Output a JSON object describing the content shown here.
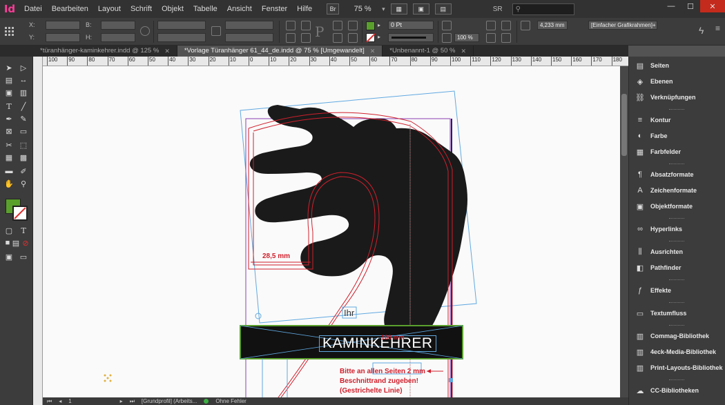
{
  "app": {
    "logo": "Id",
    "menu": [
      "Datei",
      "Bearbeiten",
      "Layout",
      "Schrift",
      "Objekt",
      "Tabelle",
      "Ansicht",
      "Fenster",
      "Hilfe"
    ],
    "bridge_label": "Br",
    "zoom": "75 %",
    "workspace": "SR",
    "search_placeholder": ""
  },
  "control_panel": {
    "x_label": "X:",
    "y_label": "Y:",
    "w_label": "B:",
    "h_label": "H:",
    "stroke_weight": "0 Pt",
    "scale_percent": "100 %",
    "offset_value": "4,233 mm",
    "frame_style": "[Einfacher Grafikrahmen]+"
  },
  "tabs": [
    {
      "label": "*türanhänger-kaminkehrer.indd @ 125 %",
      "active": false
    },
    {
      "label": "*Vorlage Türanhänger 61_44_de.indd @ 75 % [Umgewandelt]",
      "active": true
    },
    {
      "label": "*Unbenannt-1 @ 50 %",
      "active": false
    }
  ],
  "ruler": {
    "top_labels": [
      "100",
      "90",
      "80",
      "70",
      "60",
      "50",
      "40",
      "30",
      "20",
      "10",
      "0",
      "10",
      "20",
      "30",
      "40",
      "50",
      "60",
      "70",
      "80",
      "90",
      "100",
      "110",
      "120",
      "130",
      "140",
      "150",
      "160",
      "170",
      "180"
    ]
  },
  "canvas": {
    "dimension_label": "28,5 mm",
    "small_frame_text": "Ihr",
    "banner_text": "KAMINKEHRER",
    "banner_overlay_text": "100 mm",
    "note_lines": [
      "Bitte an allen Seiten 2 mm",
      "Beschnittrand zugeben!",
      "(Gestrichelte Linie)"
    ],
    "colors": {
      "guide_red": "#d0202c",
      "frame_blue": "#5fa8e0",
      "frame_purple": "#8a3fb3",
      "banner_border": "#5aa02c"
    }
  },
  "status": {
    "page": "1",
    "profile": "[Grundprofil] (Arbeits...",
    "errors": "Ohne Fehler"
  },
  "panels": [
    {
      "label": "Seiten",
      "icon": "pages-icon"
    },
    {
      "label": "Ebenen",
      "icon": "layers-icon"
    },
    {
      "label": "Verknüpfungen",
      "icon": "links-icon"
    },
    {
      "label": "Kontur",
      "icon": "stroke-icon"
    },
    {
      "label": "Farbe",
      "icon": "color-icon"
    },
    {
      "label": "Farbfelder",
      "icon": "swatches-icon"
    },
    {
      "label": "Absatzformate",
      "icon": "paragraph-styles-icon"
    },
    {
      "label": "Zeichenformate",
      "icon": "character-styles-icon"
    },
    {
      "label": "Objektformate",
      "icon": "object-styles-icon"
    },
    {
      "label": "Hyperlinks",
      "icon": "hyperlinks-icon"
    },
    {
      "label": "Ausrichten",
      "icon": "align-icon"
    },
    {
      "label": "Pathfinder",
      "icon": "pathfinder-icon"
    },
    {
      "label": "Effekte",
      "icon": "effects-icon"
    },
    {
      "label": "Textumfluss",
      "icon": "text-wrap-icon"
    },
    {
      "label": "Commag-Bibliothek",
      "icon": "library-icon"
    },
    {
      "label": "4eck-Media-Bibliothek",
      "icon": "library-icon"
    },
    {
      "label": "Print-Layouts-Bibliothek",
      "icon": "library-icon"
    },
    {
      "label": "CC-Bibliotheken",
      "icon": "cc-libraries-icon"
    }
  ]
}
